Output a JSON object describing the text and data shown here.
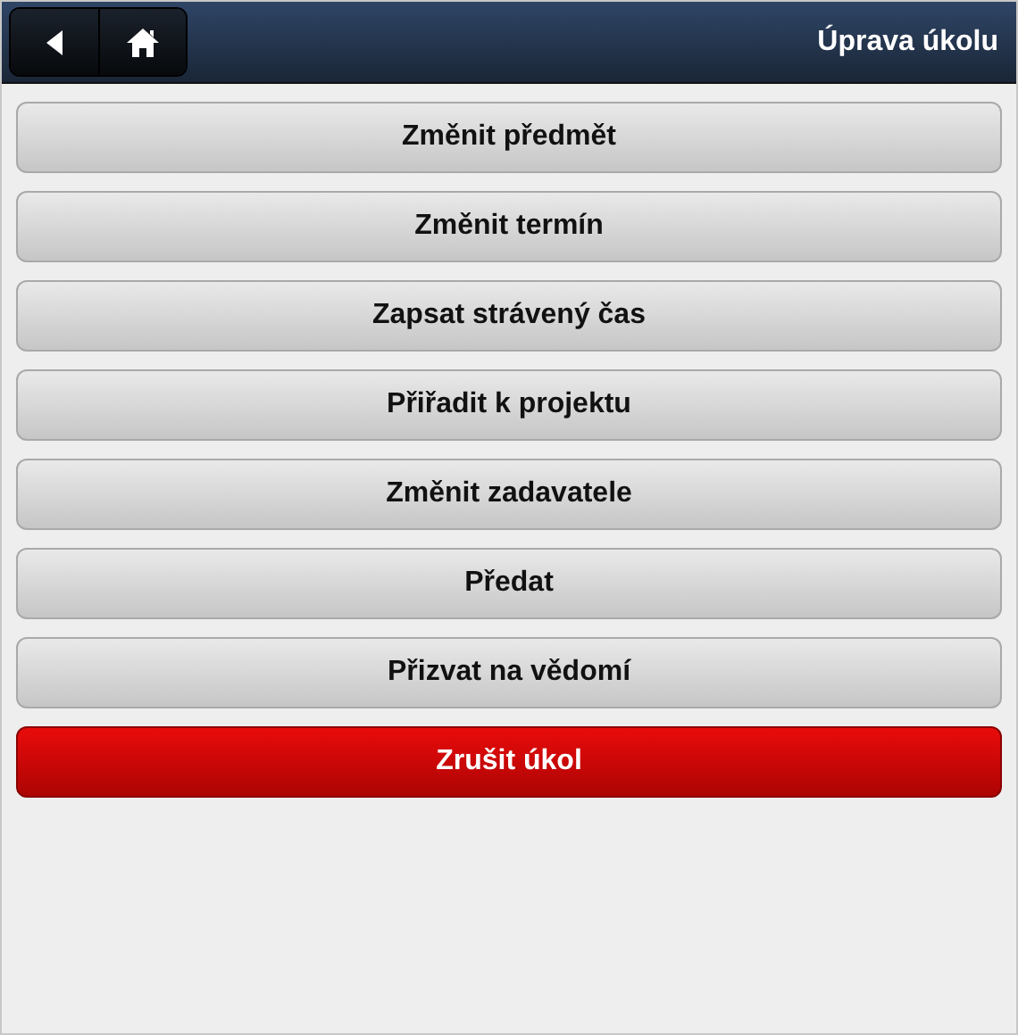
{
  "header": {
    "title": "Úprava úkolu"
  },
  "actions": [
    {
      "label": "Změnit předmět",
      "kind": "normal"
    },
    {
      "label": "Změnit termín",
      "kind": "normal"
    },
    {
      "label": "Zapsat strávený čas",
      "kind": "normal"
    },
    {
      "label": "Přiřadit k projektu",
      "kind": "normal"
    },
    {
      "label": "Změnit zadavatele",
      "kind": "normal"
    },
    {
      "label": "Předat",
      "kind": "normal"
    },
    {
      "label": "Přizvat na vědomí",
      "kind": "normal"
    },
    {
      "label": "Zrušit úkol",
      "kind": "danger"
    }
  ]
}
